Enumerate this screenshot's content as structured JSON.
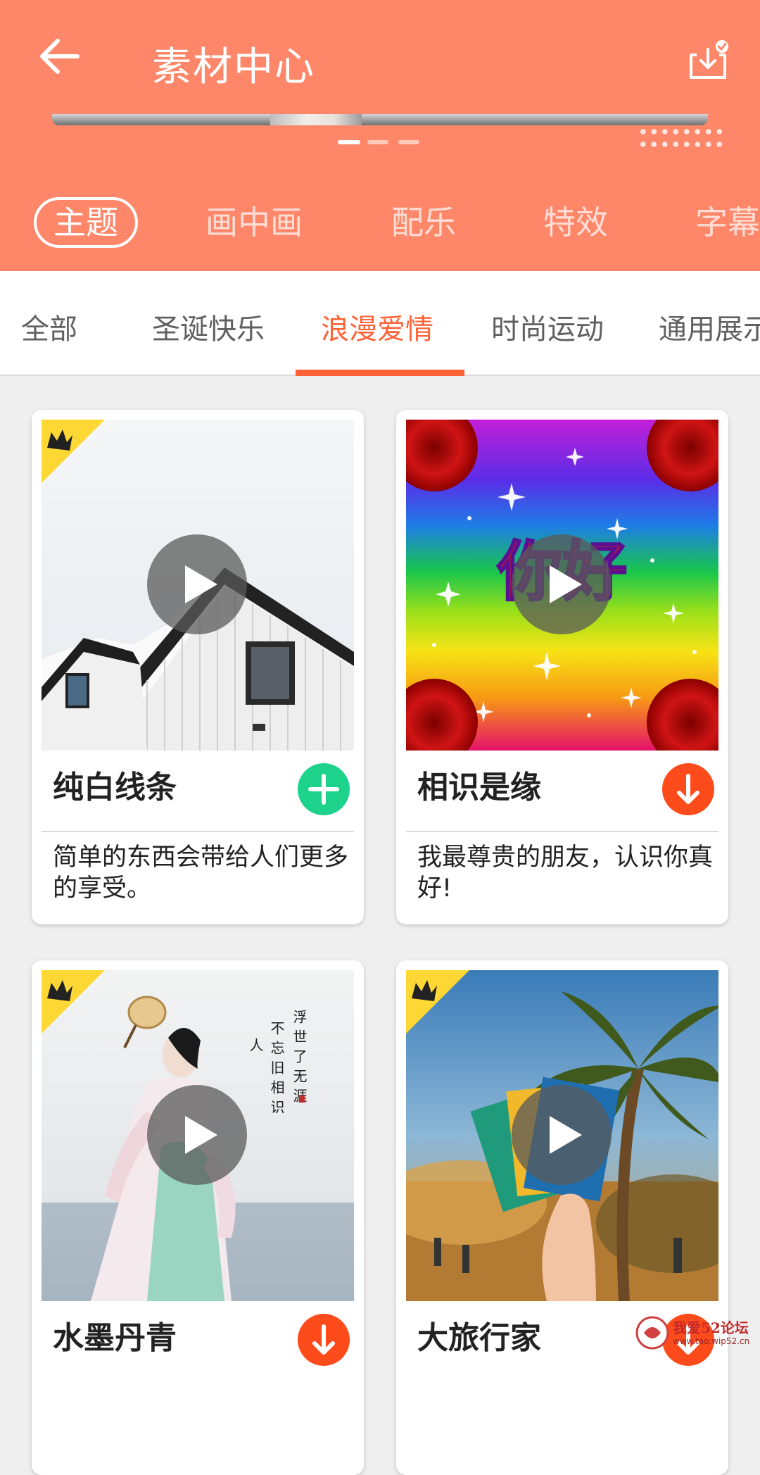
{
  "header": {
    "title": "素材中心",
    "back_icon": "arrow-left-icon",
    "download_icon": "download-check-icon",
    "pager": {
      "count": 3,
      "active_index": 0
    }
  },
  "main_tabs": [
    {
      "label": "主题",
      "active": true
    },
    {
      "label": "画中画",
      "active": false
    },
    {
      "label": "配乐",
      "active": false
    },
    {
      "label": "特效",
      "active": false
    },
    {
      "label": "字幕",
      "active": false
    }
  ],
  "sub_tabs": [
    {
      "label": "全部",
      "active": false
    },
    {
      "label": "圣诞快乐",
      "active": false
    },
    {
      "label": "浪漫爱情",
      "active": true
    },
    {
      "label": "时尚运动",
      "active": false
    },
    {
      "label": "通用展示",
      "active": false
    }
  ],
  "cards": [
    {
      "title": "纯白线条",
      "desc": "简单的东西会带给人们更多的享受。",
      "vip": true,
      "action": "add",
      "action_color": "#1dd38b"
    },
    {
      "title": "相识是缘",
      "desc": "我最尊贵的朋友，认识你真好!",
      "vip": false,
      "action": "download",
      "action_color": "#fe4b1b",
      "thumb_text": "你好"
    },
    {
      "title": "水墨丹青",
      "desc": "",
      "vip": true,
      "action": "download",
      "action_color": "#fe4b1b",
      "thumb_text": "浮世了无涯 不忘旧相识 人"
    },
    {
      "title": "大旅行家",
      "desc": "",
      "vip": true,
      "action": "download",
      "action_color": "#fe4b1b"
    }
  ],
  "watermark": {
    "text": "我爱52论坛",
    "sub": "www.tao.wip52.cn"
  },
  "colors": {
    "accent": "#fe876a",
    "active_subtab": "#fe6236",
    "add_button": "#1dd38b",
    "download_button": "#fe4b1b"
  }
}
